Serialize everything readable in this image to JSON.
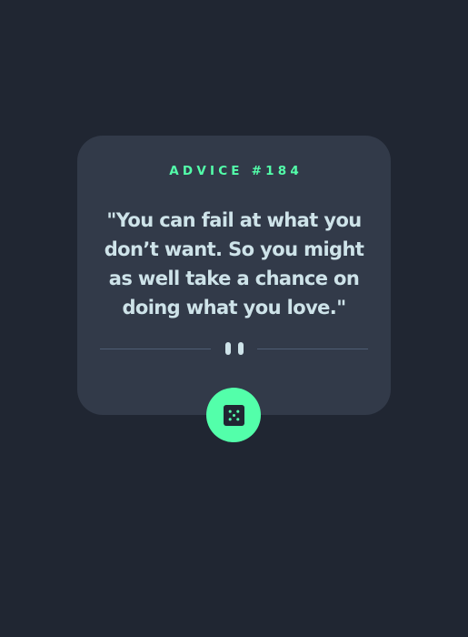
{
  "advice": {
    "label": "ADVICE #184",
    "quote": "\"You can fail at what you don’t want. So you might as well take a chance on doing what you love.\""
  },
  "colors": {
    "background": "#202632",
    "card": "#323a49",
    "accent": "#53ffaa",
    "text": "#cee3e9",
    "divider": "#4f5d74"
  },
  "icons": {
    "divider": "pause-icon",
    "button": "dice-icon"
  }
}
